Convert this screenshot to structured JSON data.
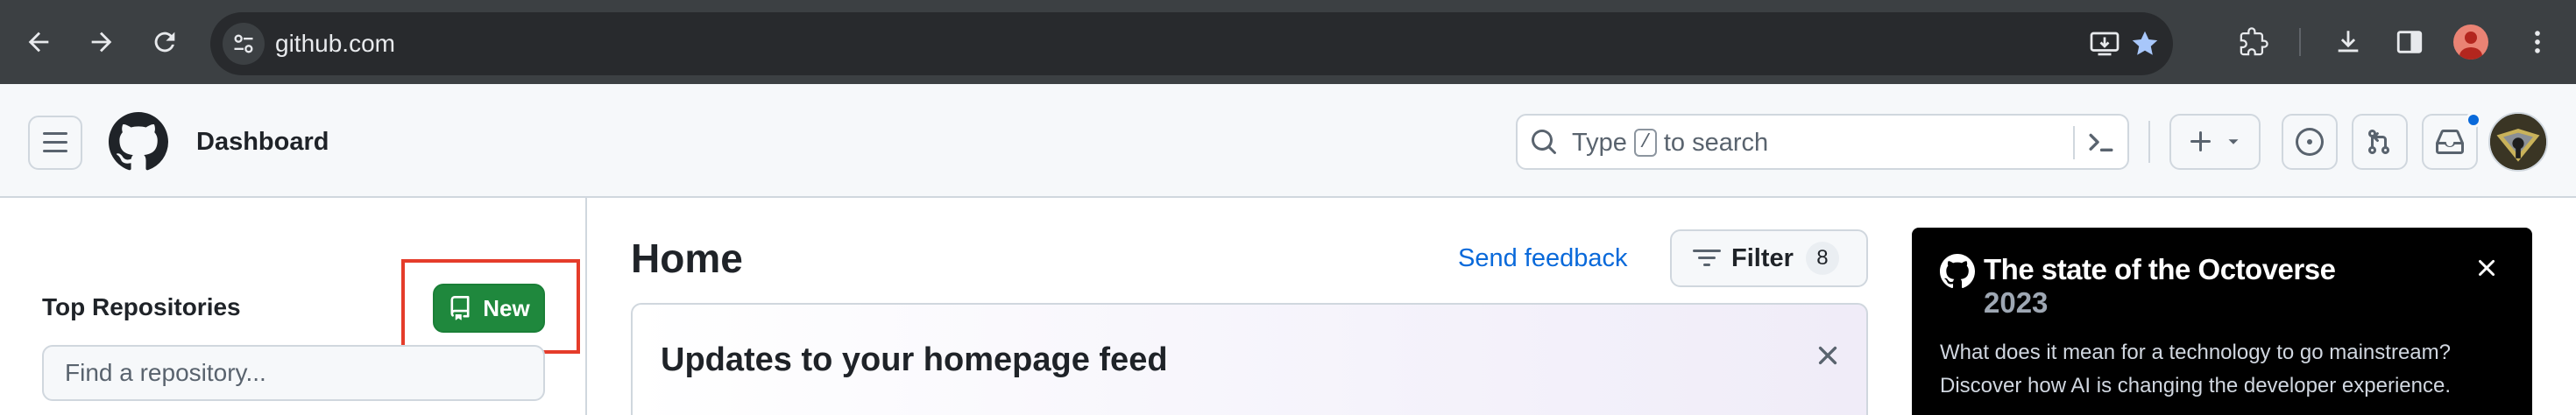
{
  "browser": {
    "url": "github.com",
    "nav": {
      "back": "back-arrow-icon",
      "forward": "forward-arrow-icon",
      "reload": "reload-icon"
    }
  },
  "header": {
    "context_title": "Dashboard",
    "search": {
      "prefix": "Type",
      "key": "/",
      "suffix": "to search"
    }
  },
  "sidebar": {
    "title": "Top Repositories",
    "new_button_label": "New",
    "find_placeholder": "Find a repository..."
  },
  "main": {
    "title": "Home",
    "feedback_link": "Send feedback",
    "filter": {
      "label": "Filter",
      "count": "8"
    },
    "updates_card": {
      "title": "Updates to your homepage feed"
    }
  },
  "promo": {
    "title": "The state of the Octoverse",
    "year": "2023",
    "body": "What does it mean for a technology to go mainstream? Discover how AI is changing the developer experience."
  },
  "colors": {
    "chrome_bg": "#3c4043",
    "header_bg": "#f6f8fa",
    "new_button": "#1f883d",
    "link": "#0969da",
    "highlight": "#e53c2a",
    "promo_bg": "#000000"
  }
}
